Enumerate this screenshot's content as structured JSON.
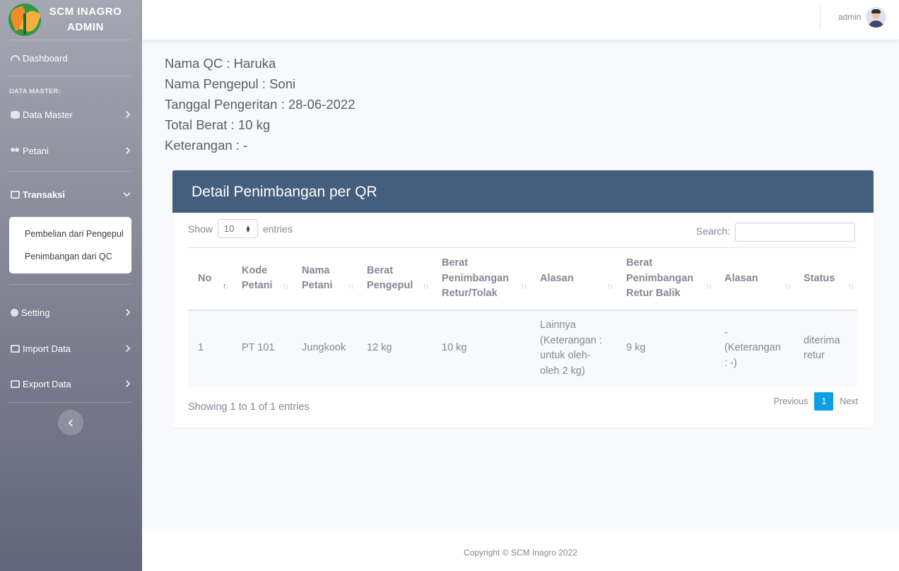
{
  "brand": {
    "line1": "SCM INAGRO",
    "line2": "ADMIN"
  },
  "sidebar": {
    "dashboard": "Dashboard",
    "heading_master": "DATA MASTER:",
    "data_master": "Data Master",
    "petani": "Petani",
    "transaksi": "Transaksi",
    "submenu": [
      "Pembelian dari Pengepul",
      "Penimbangan dari QC"
    ],
    "setting": "Setting",
    "import_data": "Import Data",
    "export_data": "Export Data"
  },
  "topbar": {
    "username": "admin"
  },
  "info": {
    "nama_qc": "Nama QC : Haruka",
    "nama_pengepul": "Nama Pengepul : Soni",
    "tanggal": "Tanggal Pengeritan : 28-06-2022",
    "total_berat": "Total Berat : 10 kg",
    "keterangan": "Keterangan : -"
  },
  "card": {
    "title": "Detail Penimbangan per QR",
    "show_label": "Show",
    "entries_value": "10",
    "entries_label": "entries",
    "search_label": "Search:",
    "columns": [
      "No",
      "Kode Petani",
      "Nama Petani",
      "Berat Pengepul",
      "Berat Penimbangan Retur/Tolak",
      "Alasan",
      "Berat Penimbangan Retur Balik",
      "Alasan",
      "Status"
    ],
    "rows": [
      [
        "1",
        "PT 101",
        "Jungkook",
        "12 kg",
        "10 kg",
        "Lainnya (Keterangan : untuk oleh-oleh 2 kg)",
        "9 kg",
        "- (Keterangan : -)",
        "diterima retur"
      ]
    ],
    "showing": "Showing 1 to 1 of 1 entries",
    "pager": {
      "previous": "Previous",
      "page": "1",
      "next": "Next"
    }
  },
  "footer": {
    "copyright": "Copyright © SCM Inagro 2022"
  },
  "colors": {
    "header": "#445e7d",
    "accent": "#0d9ee8"
  }
}
